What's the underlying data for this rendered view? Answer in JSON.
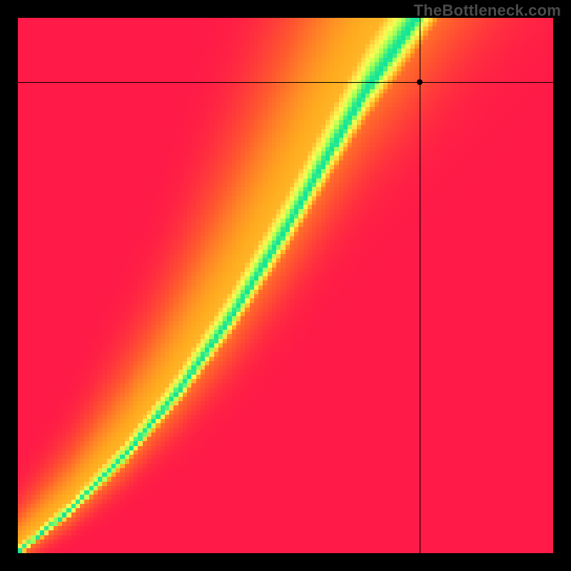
{
  "watermark": "TheBottleneck.com",
  "chart_data": {
    "type": "heatmap",
    "title": "",
    "xlabel": "",
    "ylabel": "",
    "xlim": [
      0,
      1
    ],
    "ylim": [
      0,
      1
    ],
    "grid": false,
    "resolution": 120,
    "crosshair": {
      "x": 0.75,
      "y": 0.88
    },
    "colormap": [
      {
        "t": 0.0,
        "color": "#ff1a47"
      },
      {
        "t": 0.25,
        "color": "#ff5a2e"
      },
      {
        "t": 0.5,
        "color": "#ffab1f"
      },
      {
        "t": 0.7,
        "color": "#ffe24a"
      },
      {
        "t": 0.82,
        "color": "#f5ff54"
      },
      {
        "t": 0.93,
        "color": "#9cff56"
      },
      {
        "t": 1.0,
        "color": "#12e598"
      }
    ],
    "surface": {
      "ridge_points": [
        {
          "x": 0.0,
          "y": 0.0
        },
        {
          "x": 0.1,
          "y": 0.08
        },
        {
          "x": 0.2,
          "y": 0.18
        },
        {
          "x": 0.3,
          "y": 0.3
        },
        {
          "x": 0.4,
          "y": 0.44
        },
        {
          "x": 0.5,
          "y": 0.6
        },
        {
          "x": 0.58,
          "y": 0.74
        },
        {
          "x": 0.65,
          "y": 0.86
        },
        {
          "x": 0.72,
          "y": 0.96
        },
        {
          "x": 0.78,
          "y": 1.05
        }
      ],
      "width_points": [
        {
          "x": 0.0,
          "w": 0.01
        },
        {
          "x": 0.1,
          "w": 0.015
        },
        {
          "x": 0.25,
          "w": 0.025
        },
        {
          "x": 0.4,
          "w": 0.04
        },
        {
          "x": 0.55,
          "w": 0.055
        },
        {
          "x": 0.7,
          "w": 0.07
        },
        {
          "x": 0.85,
          "w": 0.085
        },
        {
          "x": 1.0,
          "w": 0.1
        }
      ],
      "left_falloff": 0.55,
      "right_falloff": 0.95,
      "asymmetry_gain_right": 1.25
    }
  }
}
